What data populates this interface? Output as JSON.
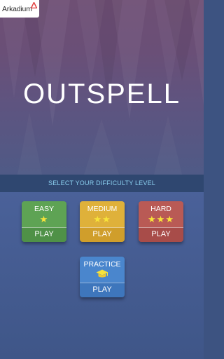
{
  "brand": {
    "name": "Arkadium"
  },
  "title": "OUTSPELL",
  "difficulty_prompt": "SELECT YOUR DIFFICULTY LEVEL",
  "modes": {
    "easy": {
      "label": "EASY",
      "stars": "★",
      "action": "PLAY"
    },
    "medium": {
      "label": "MEDIUM",
      "stars": "★★",
      "action": "PLAY"
    },
    "hard": {
      "label": "HARD",
      "stars": "★★★",
      "action": "PLAY"
    },
    "practice": {
      "label": "PRACTICE",
      "icon": "graduation-cap-icon",
      "action": "PLAY"
    }
  },
  "colors": {
    "easy": "#5ea354",
    "medium": "#dfb13a",
    "hard": "#b95a55",
    "practice": "#4a86cd",
    "prompt_text": "#8bd0f0",
    "star": "#f7e33a"
  }
}
